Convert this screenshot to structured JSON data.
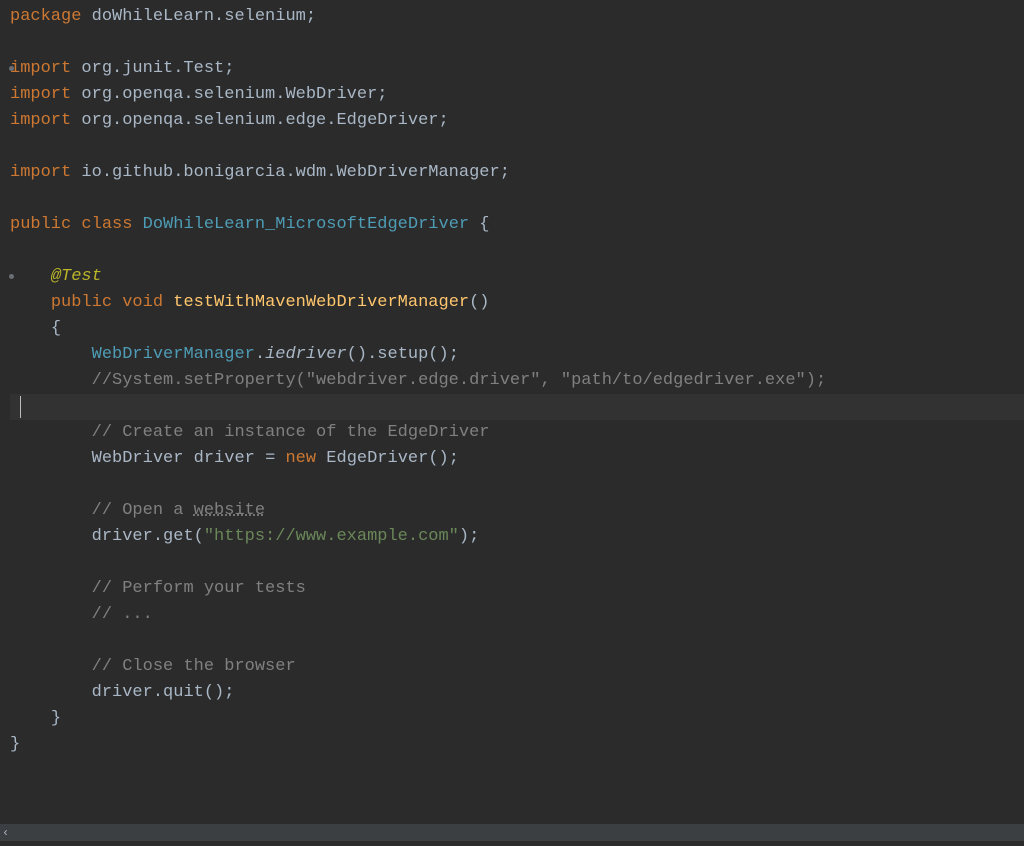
{
  "code": {
    "package_kw": "package",
    "package_name": " doWhileLearn.selenium;",
    "import_kw": "import",
    "import1": " org.junit.Test;",
    "import2": " org.openqa.selenium.WebDriver;",
    "import3": " org.openqa.selenium.edge.EdgeDriver;",
    "import4": " io.github.bonigarcia.wdm.WebDriverManager;",
    "public_kw": "public",
    "class_kw": "class",
    "class_name": "DoWhileLearn_MicrosoftEdgeDriver",
    "brace_open": "{",
    "brace_close": "}",
    "annotation": "@Test",
    "void_kw": "void",
    "method_name": "testWithMavenWebDriverManager",
    "parens": "()",
    "wdm_cls": "WebDriverManager",
    "dot": ".",
    "iedriver": "iedriver",
    "setup_call": "().setup();",
    "cmt_setprop": "//System.setProperty(\"webdriver.edge.driver\", \"path/to/edgedriver.exe\");",
    "cmt_create": "// Create an instance of the EdgeDriver",
    "webdriver_type": "WebDriver",
    "driver_var": "driver",
    "equals": " = ",
    "new_kw": "new",
    "edgedriver": "EdgeDriver",
    "edgedriver_end": "();",
    "cmt_open_a": "// Open a ",
    "cmt_open_b": "website",
    "driver_get_a": "driver.get(",
    "url_str": "\"https://www.example.com\"",
    "driver_get_b": ");",
    "cmt_perform": "// Perform your tests",
    "cmt_dots": "// ...",
    "cmt_close": "// Close the browser",
    "driver_quit": "driver.quit();"
  },
  "bottom": {
    "chevron": "‹"
  }
}
